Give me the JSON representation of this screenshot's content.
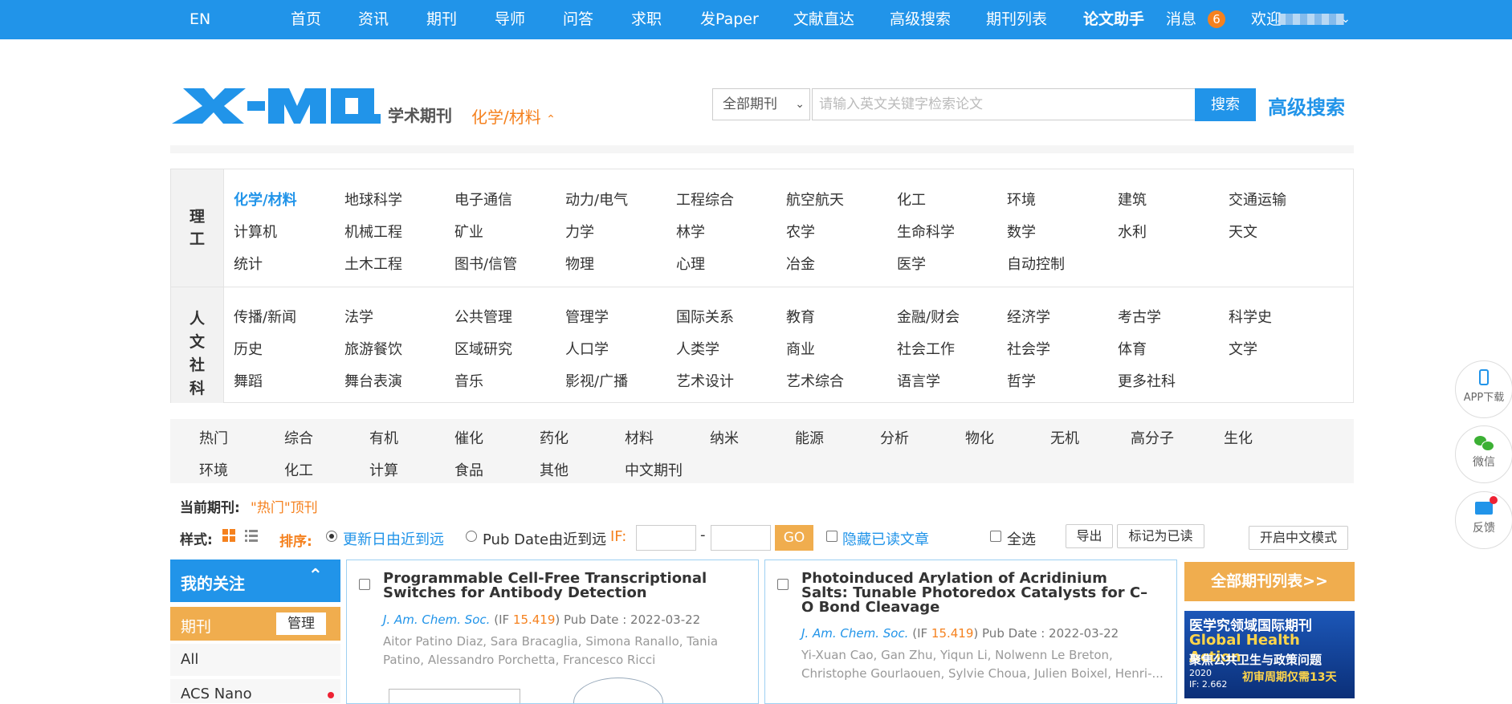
{
  "topnav": {
    "lang": "EN",
    "items": [
      "首页",
      "资讯",
      "期刊",
      "导师",
      "问答",
      "求职",
      "发Paper",
      "文献直达",
      "高级搜索",
      "期刊列表"
    ],
    "assistant": "论文助手",
    "messages": "消息",
    "message_count": "6",
    "welcome": "欢迎"
  },
  "header": {
    "logo_text": "X-MOL",
    "logo_sub": "学术期刊",
    "subject": "化学/材料",
    "journal_select": "全部期刊",
    "search_placeholder": "请输入英文关键字检索论文",
    "search_button": "搜索",
    "advanced_search": "高级搜索"
  },
  "subjects": {
    "science_label": [
      "理",
      "工"
    ],
    "science": [
      [
        "化学/材料",
        "地球科学",
        "电子通信",
        "动力/电气",
        "工程综合",
        "航空航天",
        "化工",
        "环境",
        "建筑",
        "交通运输"
      ],
      [
        "计算机",
        "机械工程",
        "矿业",
        "力学",
        "林学",
        "农学",
        "生命科学",
        "数学",
        "水利",
        "天文"
      ],
      [
        "统计",
        "土木工程",
        "图书/信管",
        "物理",
        "心理",
        "冶金",
        "医学",
        "自动控制"
      ]
    ],
    "humanities_label": [
      "人",
      "文",
      "社",
      "科"
    ],
    "humanities": [
      [
        "传播/新闻",
        "法学",
        "公共管理",
        "管理学",
        "国际关系",
        "教育",
        "金融/财会",
        "经济学",
        "考古学",
        "科学史"
      ],
      [
        "历史",
        "旅游餐饮",
        "区域研究",
        "人口学",
        "人类学",
        "商业",
        "社会工作",
        "社会学",
        "体育",
        "文学"
      ],
      [
        "舞蹈",
        "舞台表演",
        "音乐",
        "影视/广播",
        "艺术设计",
        "艺术综合",
        "语言学",
        "哲学",
        "更多社科"
      ]
    ]
  },
  "tabs": [
    [
      "热门",
      "综合",
      "有机",
      "催化",
      "药化",
      "材料",
      "纳米",
      "能源",
      "分析",
      "物化",
      "无机",
      "高分子",
      "生化"
    ],
    [
      "环境",
      "化工",
      "计算",
      "食品",
      "其他",
      "中文期刊"
    ]
  ],
  "filters": {
    "current_label": "当前期刊:",
    "current_value": "\"热门\"顶刊",
    "style_label": "样式:",
    "sort_label": "排序:",
    "sort_update": "更新日由近到远",
    "sort_pub": "Pub Date由近到远",
    "if_label": "IF:",
    "if_dash": "-",
    "go": "GO",
    "hide_read": "隐藏已读文章",
    "select_all": "全选",
    "export": "导出",
    "mark_read": "标记为已读",
    "chinese_mode": "开启中文模式"
  },
  "sidebar": {
    "follow": "我的关注",
    "journals": "期刊",
    "manage": "管理",
    "items": [
      "All",
      "ACS Nano"
    ]
  },
  "articles": [
    {
      "title": "Programmable Cell-Free Transcriptional Switches for Antibody Detection",
      "journal": "J. Am. Chem. Soc.",
      "if_prefix": "(IF ",
      "if": "15.419",
      "pub": ") Pub Date : 2022-03-22",
      "authors": "Aitor Patino Diaz, Sara Bracaglia, Simona Ranallo, Tania Patino, Alessandro Porchetta, Francesco Ricci"
    },
    {
      "title": "Photoinduced Arylation of Acridinium Salts: Tunable Photoredox Catalysts for C–O Bond Cleavage",
      "journal": "J. Am. Chem. Soc.",
      "if_prefix": "(IF ",
      "if": "15.419",
      "pub": ") Pub Date : 2022-03-22",
      "authors": "Yi-Xuan Cao, Gan Zhu, Yiqun Li, Nolwenn Le Breton, Christophe Gourlaouen, Sylvie Choua, Julien Boixel, Henri-..."
    }
  ],
  "right": {
    "all_journals": "全部期刊列表>>",
    "ad_line1": "医学究领域国际期刊",
    "ad_line2": "Global Health Action",
    "ad_line3": "聚焦公共卫生与政策问题",
    "ad_line4": "初审周期仅需13天",
    "ad_year": "2020",
    "ad_if": "IF: 2.662"
  },
  "floating": {
    "app": "APP下载",
    "wechat": "微信",
    "feedback": "反馈"
  },
  "colors": {
    "brand_blue": "#2194e9",
    "accent_orange": "#f5811e",
    "gold": "#f0ad4e"
  }
}
